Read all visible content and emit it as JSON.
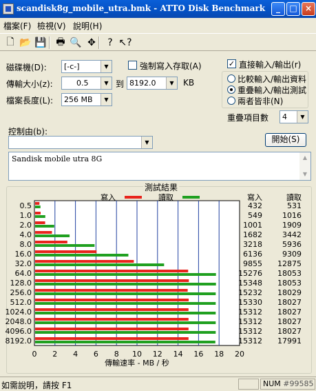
{
  "window": {
    "title": "scandisk8g_mobile_utra.bmk - ATTO Disk Benchmark",
    "minimize": "_",
    "maximize": "□",
    "close": "×"
  },
  "menu": {
    "file": "檔案(F)",
    "view": "檢視(V)",
    "help": "說明(H)"
  },
  "toolbar": {
    "icons": [
      "new-file-icon",
      "open-folder-icon",
      "save-disk-icon",
      "print-icon",
      "print-preview-icon",
      "move-icon",
      "help-icon",
      "context-help-icon"
    ],
    "glyphs": [
      "🗋",
      "📂",
      "💾",
      "🖶",
      "🔍",
      "✥",
      "?",
      "↖?"
    ]
  },
  "settings": {
    "drive_label": "磁碟機(D):",
    "drive_value": "[-c-]",
    "force_write_label": "強制寫入存取(A)",
    "transfer_label": "傳輸大小(z):",
    "transfer_from": "0.5",
    "transfer_to_label": "到",
    "transfer_to": "8192.0",
    "transfer_unit": "KB",
    "length_label": "檔案長度(L):",
    "length_value": "256 MB",
    "direct_io_label": "直接輸入/輸出(r)",
    "compare_label": "比較輸入/輸出資料",
    "overlap_label": "重疊輸入/輸出測試",
    "neither_label": "兩者皆非(N)",
    "queue_label": "重疊項目數",
    "queue_value": "4",
    "control_label": "控制由(b):",
    "control_value": "",
    "start_button": "開始(S)",
    "description": "Sandisk mobile utra 8G"
  },
  "results": {
    "group_title": "測試結果",
    "write_header": "寫入",
    "read_header": "讀取",
    "write_color": "#e8241c",
    "read_color": "#20a020",
    "write_col_header": "寫入",
    "read_col_header": "讀取"
  },
  "chart_data": {
    "type": "bar",
    "orientation": "horizontal",
    "xlabel": "傳輸速率 - MB / 秒",
    "xlim": [
      0,
      20
    ],
    "xticks": [
      "0",
      "2",
      "4",
      "6",
      "8",
      "10",
      "12",
      "14",
      "16",
      "18",
      "20"
    ],
    "grid": true,
    "categories": [
      "0.5",
      "1.0",
      "2.0",
      "4.0",
      "8.0",
      "16.0",
      "32.0",
      "64.0",
      "128.0",
      "256.0",
      "512.0",
      "1024.0",
      "2048.0",
      "4096.0",
      "8192.0"
    ],
    "series": [
      {
        "name": "寫入",
        "values": [
          432,
          549,
          1001,
          1682,
          3218,
          6136,
          9855,
          15276,
          15348,
          15232,
          15330,
          15312,
          15312,
          15312,
          15312
        ]
      },
      {
        "name": "讀取",
        "values": [
          531,
          1016,
          1909,
          3442,
          5936,
          9309,
          12875,
          18053,
          18053,
          18029,
          18027,
          18027,
          18027,
          18027,
          17991
        ]
      }
    ],
    "write_texts": [
      "432",
      "549",
      "1001",
      "1682",
      "3218",
      "6136",
      "9855",
      "15276",
      "15348",
      "15232",
      "15330",
      "15312",
      "15312",
      "15312",
      "15312"
    ],
    "read_texts": [
      "531",
      "1016",
      "1909",
      "3442",
      "5936",
      "9309",
      "12875",
      "18053",
      "18053",
      "18029",
      "18027",
      "18027",
      "18027",
      "18027",
      "17991"
    ]
  },
  "status": {
    "help_text": "如需說明，請按 F1",
    "num": "NUM",
    "extra": "#99585"
  }
}
